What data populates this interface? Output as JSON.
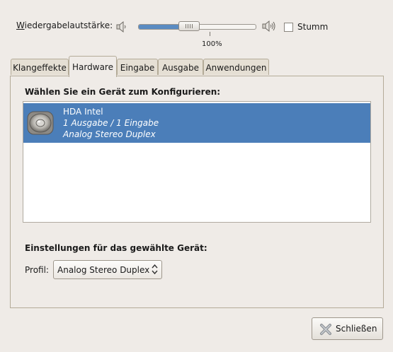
{
  "volume": {
    "label": "Wiedergabelautstärke:",
    "level_percent": 40,
    "value_text": "100%",
    "mute_label": "Stumm",
    "mute_checked": false
  },
  "tabs": [
    {
      "label": "Klangeffekte",
      "active": false
    },
    {
      "label": "Hardware",
      "active": true
    },
    {
      "label": "Eingabe",
      "active": false
    },
    {
      "label": "Ausgabe",
      "active": false
    },
    {
      "label": "Anwendungen",
      "active": false
    }
  ],
  "hardware": {
    "heading": "Wählen Sie ein Gerät zum Konfigurieren:",
    "devices": [
      {
        "name": "HDA Intel",
        "io": "1 Ausgabe / 1 Eingabe",
        "profile": "Analog Stereo Duplex",
        "selected": true,
        "icon": "speaker-icon"
      }
    ],
    "settings_heading": "Einstellungen für das gewählte Gerät:",
    "profile_label": "Profil:",
    "profile_value": "Analog Stereo Duplex"
  },
  "footer": {
    "close_label": "Schließen",
    "close_icon": "close-icon"
  },
  "colors": {
    "background": "#efebe7",
    "selection": "#4b7eb9",
    "slider_fill": "#5a8bc2"
  }
}
